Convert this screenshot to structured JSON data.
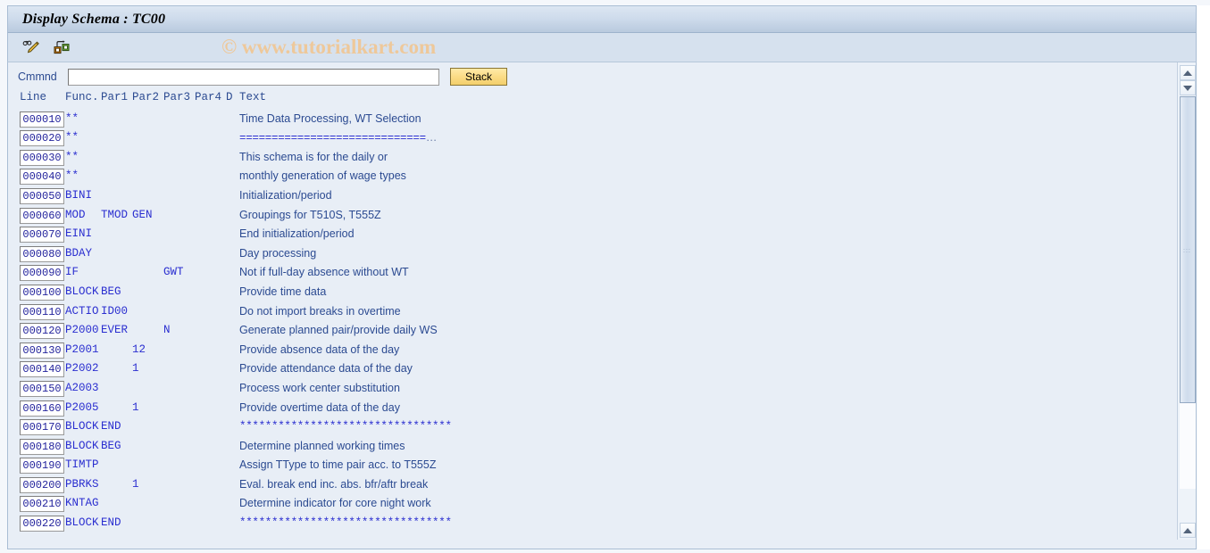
{
  "window": {
    "title": "Display Schema : TC00",
    "watermark": "© www.tutorialkart.com"
  },
  "toolbar": {
    "buttons": [
      {
        "name": "display-change-icon",
        "tooltip": "Display <-> Change"
      },
      {
        "name": "hierarchy-icon",
        "tooltip": "Structure / Hierarchy"
      }
    ]
  },
  "command": {
    "label": "Cmmnd",
    "value": "",
    "placeholder": "",
    "stack_label": "Stack"
  },
  "table": {
    "headers": {
      "line": "Line",
      "func": "Func.",
      "par1": "Par1",
      "par2": "Par2",
      "par3": "Par3",
      "par4": "Par4",
      "d": "D",
      "text": "Text"
    },
    "rows": [
      {
        "line": "000010",
        "func": "**",
        "par1": "",
        "par2": "",
        "par3": "",
        "par4": "",
        "d": "",
        "text": "Time Data Processing, WT Selection",
        "sep": false
      },
      {
        "line": "000020",
        "func": "**",
        "par1": "",
        "par2": "",
        "par3": "",
        "par4": "",
        "d": "",
        "text": "=============================",
        "sep": true,
        "ellipsis": true
      },
      {
        "line": "000030",
        "func": "**",
        "par1": "",
        "par2": "",
        "par3": "",
        "par4": "",
        "d": "",
        "text": "This schema is for the daily or",
        "sep": false
      },
      {
        "line": "000040",
        "func": "**",
        "par1": "",
        "par2": "",
        "par3": "",
        "par4": "",
        "d": "",
        "text": "monthly generation of wage types",
        "sep": false
      },
      {
        "line": "000050",
        "func": "BINI",
        "par1": "",
        "par2": "",
        "par3": "",
        "par4": "",
        "d": "",
        "text": "Initialization/period",
        "sep": false
      },
      {
        "line": "000060",
        "func": "MOD",
        "par1": "TMOD",
        "par2": "GEN",
        "par3": "",
        "par4": "",
        "d": "",
        "text": "Groupings for T510S, T555Z",
        "sep": false
      },
      {
        "line": "000070",
        "func": "EINI",
        "par1": "",
        "par2": "",
        "par3": "",
        "par4": "",
        "d": "",
        "text": "End initialization/period",
        "sep": false
      },
      {
        "line": "000080",
        "func": "BDAY",
        "par1": "",
        "par2": "",
        "par3": "",
        "par4": "",
        "d": "",
        "text": "Day processing",
        "sep": false
      },
      {
        "line": "000090",
        "func": "IF",
        "par1": "",
        "par2": "",
        "par3": "GWT",
        "par4": "",
        "d": "",
        "text": "Not if full-day absence without WT",
        "sep": false
      },
      {
        "line": "000100",
        "func": "BLOCK",
        "par1": "BEG",
        "par2": "",
        "par3": "",
        "par4": "",
        "d": "",
        "text": "Provide time data",
        "sep": false
      },
      {
        "line": "000110",
        "func": "ACTIO",
        "par1": "ID00",
        "par2": "",
        "par3": "",
        "par4": "",
        "d": "",
        "text": "Do not import breaks in overtime",
        "sep": false
      },
      {
        "line": "000120",
        "func": "P2000",
        "par1": "EVER",
        "par2": "",
        "par3": "N",
        "par4": "",
        "d": "",
        "text": "Generate planned pair/provide daily WS",
        "sep": false
      },
      {
        "line": "000130",
        "func": "P2001",
        "par1": "",
        "par2": "12",
        "par3": "",
        "par4": "",
        "d": "",
        "text": "Provide absence data of the day",
        "sep": false
      },
      {
        "line": "000140",
        "func": "P2002",
        "par1": "",
        "par2": "1",
        "par3": "",
        "par4": "",
        "d": "",
        "text": "Provide attendance data of the day",
        "sep": false
      },
      {
        "line": "000150",
        "func": "A2003",
        "par1": "",
        "par2": "",
        "par3": "",
        "par4": "",
        "d": "",
        "text": "Process work center substitution",
        "sep": false
      },
      {
        "line": "000160",
        "func": "P2005",
        "par1": "",
        "par2": "1",
        "par3": "",
        "par4": "",
        "d": "",
        "text": "Provide overtime data of the day",
        "sep": false
      },
      {
        "line": "000170",
        "func": "BLOCK",
        "par1": "END",
        "par2": "",
        "par3": "",
        "par4": "",
        "d": "",
        "text": "*********************************",
        "sep": true
      },
      {
        "line": "000180",
        "func": "BLOCK",
        "par1": "BEG",
        "par2": "",
        "par3": "",
        "par4": "",
        "d": "",
        "text": "Determine planned working times",
        "sep": false
      },
      {
        "line": "000190",
        "func": "TIMTP",
        "par1": "",
        "par2": "",
        "par3": "",
        "par4": "",
        "d": "",
        "text": "Assign TType to time pair acc. to T555Z",
        "sep": false
      },
      {
        "line": "000200",
        "func": "PBRKS",
        "par1": "",
        "par2": "1",
        "par3": "",
        "par4": "",
        "d": "",
        "text": "Eval. break end inc. abs. bfr/aftr break",
        "sep": false
      },
      {
        "line": "000210",
        "func": "KNTAG",
        "par1": "",
        "par2": "",
        "par3": "",
        "par4": "",
        "d": "",
        "text": "Determine indicator for core night work",
        "sep": false
      },
      {
        "line": "000220",
        "func": "BLOCK",
        "par1": "END",
        "par2": "",
        "par3": "",
        "par4": "",
        "d": "",
        "text": "*********************************",
        "sep": true
      }
    ]
  },
  "colors": {
    "title_gradient_top": "#dce6f2",
    "title_gradient_bottom": "#b9cade",
    "toolbar_bg": "#d6e1ee",
    "content_bg": "#e8eef6",
    "label_blue": "#2b4a91",
    "code_blue": "#2b2fd0",
    "watermark": "#eec89a",
    "stack_button": "#fbdc86"
  },
  "scrollbar": {
    "up_arrow": "scroll-up-arrow",
    "down_arrow": "scroll-down-arrow",
    "bottom_arrow": "scroll-bottom-arrow"
  }
}
